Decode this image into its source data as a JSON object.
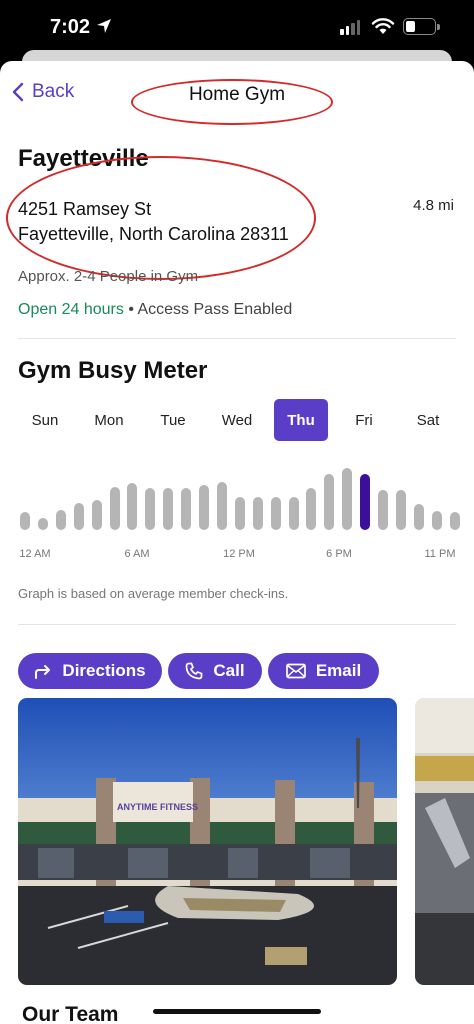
{
  "status_bar": {
    "time": "7:02"
  },
  "nav": {
    "back_label": "Back",
    "title": "Home Gym"
  },
  "gym": {
    "name": "Fayetteville",
    "address_line1": "4251 Ramsey St",
    "address_line2": "Fayetteville, North Carolina 28311",
    "distance": "4.8 mi",
    "occupancy": "Approx. 2-4 People in Gym",
    "hours": "Open 24 hours",
    "separator": "•",
    "access": "Access Pass Enabled"
  },
  "busy_meter": {
    "title": "Gym Busy Meter",
    "days": [
      "Sun",
      "Mon",
      "Tue",
      "Wed",
      "Thu",
      "Fri",
      "Sat"
    ],
    "selected_day": "Thu",
    "time_labels": [
      "12 AM",
      "6 AM",
      "12 PM",
      "6 PM",
      "11 PM"
    ],
    "note": "Graph is based on average member check-ins.",
    "current_hour_index": 19,
    "relative_busyness": [
      0.28,
      0.18,
      0.32,
      0.42,
      0.47,
      0.67,
      0.73,
      0.65,
      0.65,
      0.66,
      0.71,
      0.75,
      0.51,
      0.51,
      0.51,
      0.51,
      0.66,
      0.87,
      0.97,
      0.87,
      0.63,
      0.63,
      0.41,
      0.29,
      0.28
    ]
  },
  "actions": {
    "directions": "Directions",
    "call": "Call",
    "email": "Email"
  },
  "photos": {
    "storefront_sign": "ANYTIME FITNESS"
  },
  "team": {
    "title": "Our Team"
  },
  "colors": {
    "accent": "#5a3ec8",
    "current_bar": "#3b0f9a",
    "open_green": "#1a8a5a",
    "annotation": "#d42a2a"
  }
}
